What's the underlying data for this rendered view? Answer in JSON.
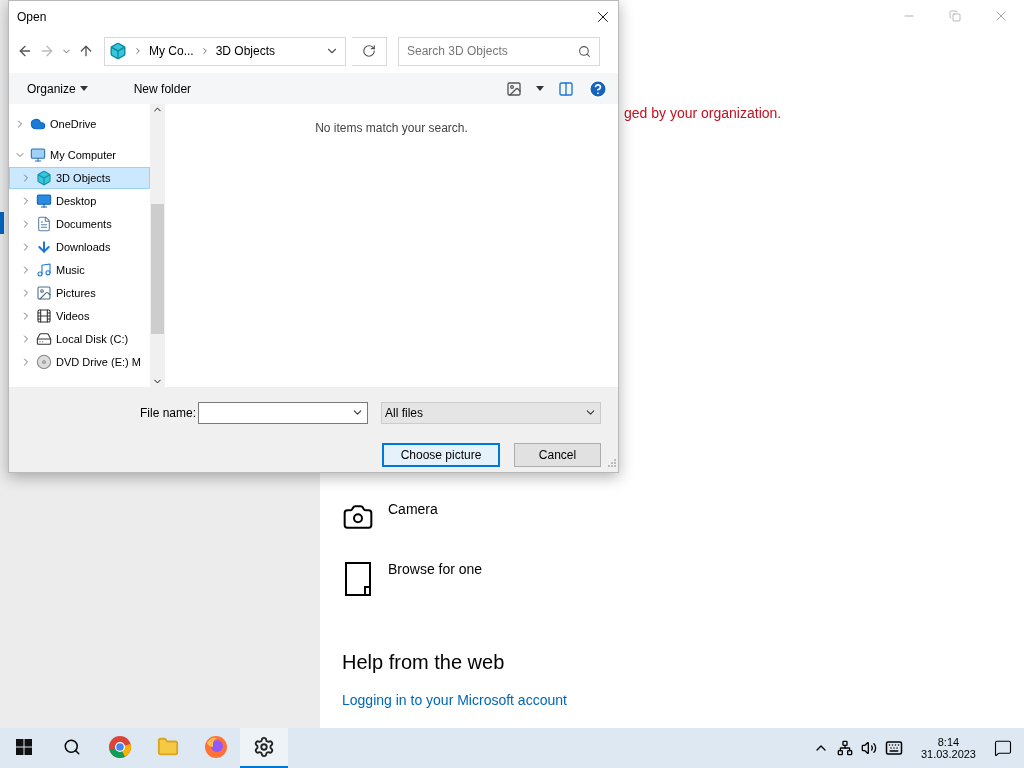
{
  "settings_window": {
    "warning": "ged by your organization.",
    "options": [
      {
        "label": "Camera",
        "kind": "camera"
      },
      {
        "label": "Browse for one",
        "kind": "browse"
      }
    ],
    "help_title": "Help from the web",
    "help_link": "Logging in to your Microsoft account"
  },
  "dialog": {
    "title": "Open",
    "breadcrumbs": [
      "My Co...",
      "3D Objects"
    ],
    "search": {
      "placeholder": "Search 3D Objects"
    },
    "toolbar": {
      "organize": "Organize",
      "new_folder": "New folder"
    },
    "tree": [
      {
        "label": "OneDrive",
        "kind": "cloud",
        "expanded": false,
        "selected": false
      },
      {
        "label": "My Computer",
        "kind": "computer",
        "expanded": true,
        "selected": false,
        "children": [
          {
            "label": "3D Objects",
            "kind": "cube",
            "expanded": false,
            "selected": true
          },
          {
            "label": "Desktop",
            "kind": "desktop",
            "expanded": false,
            "selected": false
          },
          {
            "label": "Documents",
            "kind": "document",
            "expanded": false,
            "selected": false
          },
          {
            "label": "Downloads",
            "kind": "download",
            "expanded": false,
            "selected": false
          },
          {
            "label": "Music",
            "kind": "music",
            "expanded": false,
            "selected": false
          },
          {
            "label": "Pictures",
            "kind": "picture",
            "expanded": false,
            "selected": false
          },
          {
            "label": "Videos",
            "kind": "video",
            "expanded": false,
            "selected": false
          },
          {
            "label": "Local Disk (C:)",
            "kind": "disk",
            "expanded": false,
            "selected": false
          },
          {
            "label": "DVD Drive (E:) M",
            "kind": "dvd",
            "expanded": false,
            "selected": false
          }
        ]
      }
    ],
    "empty_message": "No items match your search.",
    "file_name": {
      "label": "File name:"
    },
    "file_type": "All files",
    "buttons": [
      {
        "label": "Choose picture",
        "default": true
      },
      {
        "label": "Cancel",
        "default": false
      }
    ]
  },
  "taskbar": {
    "apps": [
      {
        "kind": "chrome",
        "active": false
      },
      {
        "kind": "explorer",
        "active": false
      },
      {
        "kind": "firefox",
        "active": false
      },
      {
        "kind": "settings",
        "active": true
      }
    ],
    "time": "8:14",
    "date": "31.03.2023"
  }
}
